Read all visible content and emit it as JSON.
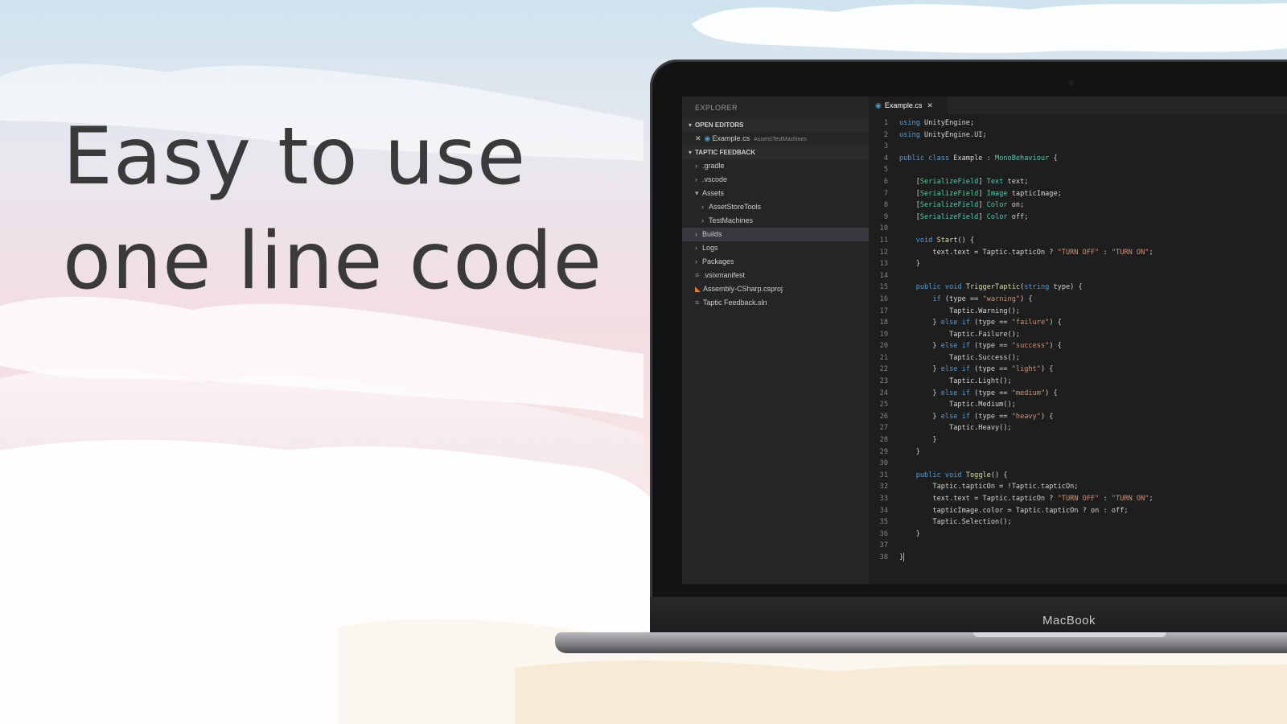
{
  "headline": {
    "line1": "Easy to use",
    "line2": "one line code"
  },
  "device": {
    "brand": "MacBook"
  },
  "colors": {
    "keyword": "#569cd6",
    "type": "#4ec9b0",
    "string": "#ce9178",
    "text": "#d4d4d4",
    "function": "#dcdcaa",
    "variable": "#9cdcfe"
  },
  "explorer": {
    "title": "EXPLORER",
    "open_editors_label": "OPEN EDITORS",
    "open_file": {
      "name": "Example.cs",
      "path": "Assets\\TestMachines"
    },
    "project_label": "TAPTIC FEEDBACK",
    "items": [
      {
        "label": ".gradle",
        "indent": 1,
        "icon": "chevron-right-icon"
      },
      {
        "label": ".vscode",
        "indent": 1,
        "icon": "chevron-right-icon"
      },
      {
        "label": "Assets",
        "indent": 1,
        "icon": "chevron-down-icon"
      },
      {
        "label": "AssetStoreTools",
        "indent": 2,
        "icon": "chevron-right-icon"
      },
      {
        "label": "TestMachines",
        "indent": 2,
        "icon": "chevron-right-icon"
      },
      {
        "label": "Builds",
        "indent": 1,
        "icon": "chevron-right-icon",
        "selected": true
      },
      {
        "label": "Logs",
        "indent": 1,
        "icon": "chevron-right-icon"
      },
      {
        "label": "Packages",
        "indent": 1,
        "icon": "chevron-right-icon"
      },
      {
        "label": ".vsixmanifest",
        "indent": 1,
        "icon": "file-icon"
      },
      {
        "label": "Assembly-CSharp.csproj",
        "indent": 1,
        "icon": "rss-file-icon"
      },
      {
        "label": "Taptic Feedback.sln",
        "indent": 1,
        "icon": "file-icon"
      }
    ]
  },
  "editor": {
    "tab_label": "Example.cs",
    "lines": [
      [
        [
          "using ",
          "keyword"
        ],
        [
          "UnityEngine;",
          "text"
        ]
      ],
      [
        [
          "using ",
          "keyword"
        ],
        [
          "UnityEngine.UI;",
          "text"
        ]
      ],
      [],
      [
        [
          "public class ",
          "keyword"
        ],
        [
          "Example",
          "text"
        ],
        [
          " : ",
          "text"
        ],
        [
          "MonoBehaviour",
          "type"
        ],
        [
          " {",
          "text"
        ]
      ],
      [],
      [
        [
          "    [",
          "text"
        ],
        [
          "SerializeField",
          "type"
        ],
        [
          "] ",
          "text"
        ],
        [
          "Text",
          "type"
        ],
        [
          " text;",
          "text"
        ]
      ],
      [
        [
          "    [",
          "text"
        ],
        [
          "SerializeField",
          "type"
        ],
        [
          "] ",
          "text"
        ],
        [
          "Image",
          "type"
        ],
        [
          " tapticImage;",
          "text"
        ]
      ],
      [
        [
          "    [",
          "text"
        ],
        [
          "SerializeField",
          "type"
        ],
        [
          "] ",
          "text"
        ],
        [
          "Color",
          "type"
        ],
        [
          " on;",
          "text"
        ]
      ],
      [
        [
          "    [",
          "text"
        ],
        [
          "SerializeField",
          "type"
        ],
        [
          "] ",
          "text"
        ],
        [
          "Color",
          "type"
        ],
        [
          " off;",
          "text"
        ]
      ],
      [],
      [
        [
          "    void ",
          "keyword"
        ],
        [
          "Start",
          "function"
        ],
        [
          "() {",
          "text"
        ]
      ],
      [
        [
          "        text.text = Taptic.tapticOn ? ",
          "text"
        ],
        [
          "\"TURN OFF\"",
          "string"
        ],
        [
          " : ",
          "text"
        ],
        [
          "\"TURN ON\"",
          "string"
        ],
        [
          ";",
          "text"
        ]
      ],
      [
        [
          "    }",
          "text"
        ]
      ],
      [],
      [
        [
          "    public void ",
          "keyword"
        ],
        [
          "TriggerTaptic",
          "function"
        ],
        [
          "(",
          "text"
        ],
        [
          "string",
          "keyword"
        ],
        [
          " type) {",
          "text"
        ]
      ],
      [
        [
          "        if ",
          "keyword"
        ],
        [
          "(type == ",
          "text"
        ],
        [
          "\"warning\"",
          "string"
        ],
        [
          ") {",
          "text"
        ]
      ],
      [
        [
          "            Taptic.Warning();",
          "text"
        ]
      ],
      [
        [
          "        } ",
          "text"
        ],
        [
          "else if ",
          "keyword"
        ],
        [
          "(type == ",
          "text"
        ],
        [
          "\"failure\"",
          "string"
        ],
        [
          ") {",
          "text"
        ]
      ],
      [
        [
          "            Taptic.Failure();",
          "text"
        ]
      ],
      [
        [
          "        } ",
          "text"
        ],
        [
          "else if ",
          "keyword"
        ],
        [
          "(type == ",
          "text"
        ],
        [
          "\"success\"",
          "string"
        ],
        [
          ") {",
          "text"
        ]
      ],
      [
        [
          "            Taptic.Success();",
          "text"
        ]
      ],
      [
        [
          "        } ",
          "text"
        ],
        [
          "else if ",
          "keyword"
        ],
        [
          "(type == ",
          "text"
        ],
        [
          "\"light\"",
          "string"
        ],
        [
          ") {",
          "text"
        ]
      ],
      [
        [
          "            Taptic.Light();",
          "text"
        ]
      ],
      [
        [
          "        } ",
          "text"
        ],
        [
          "else if ",
          "keyword"
        ],
        [
          "(type == ",
          "text"
        ],
        [
          "\"medium\"",
          "string"
        ],
        [
          ") {",
          "text"
        ]
      ],
      [
        [
          "            Taptic.Medium();",
          "text"
        ]
      ],
      [
        [
          "        } ",
          "text"
        ],
        [
          "else if ",
          "keyword"
        ],
        [
          "(type == ",
          "text"
        ],
        [
          "\"heavy\"",
          "string"
        ],
        [
          ") {",
          "text"
        ]
      ],
      [
        [
          "            Taptic.Heavy();",
          "text"
        ]
      ],
      [
        [
          "        }",
          "text"
        ]
      ],
      [
        [
          "    }",
          "text"
        ]
      ],
      [],
      [
        [
          "    public void ",
          "keyword"
        ],
        [
          "Toggle",
          "function"
        ],
        [
          "() {",
          "text"
        ]
      ],
      [
        [
          "        Taptic.tapticOn = !Taptic.tapticOn;",
          "text"
        ]
      ],
      [
        [
          "        text.text = Taptic.tapticOn ? ",
          "text"
        ],
        [
          "\"TURN OFF\"",
          "string"
        ],
        [
          " : ",
          "text"
        ],
        [
          "\"TURN ON\"",
          "string"
        ],
        [
          ";",
          "text"
        ]
      ],
      [
        [
          "        tapticImage.color = Taptic.tapticOn ? on : off;",
          "text"
        ]
      ],
      [
        [
          "        Taptic.Selection();",
          "text"
        ]
      ],
      [
        [
          "    }",
          "text"
        ]
      ],
      [],
      [
        [
          "}",
          "text"
        ]
      ]
    ]
  }
}
